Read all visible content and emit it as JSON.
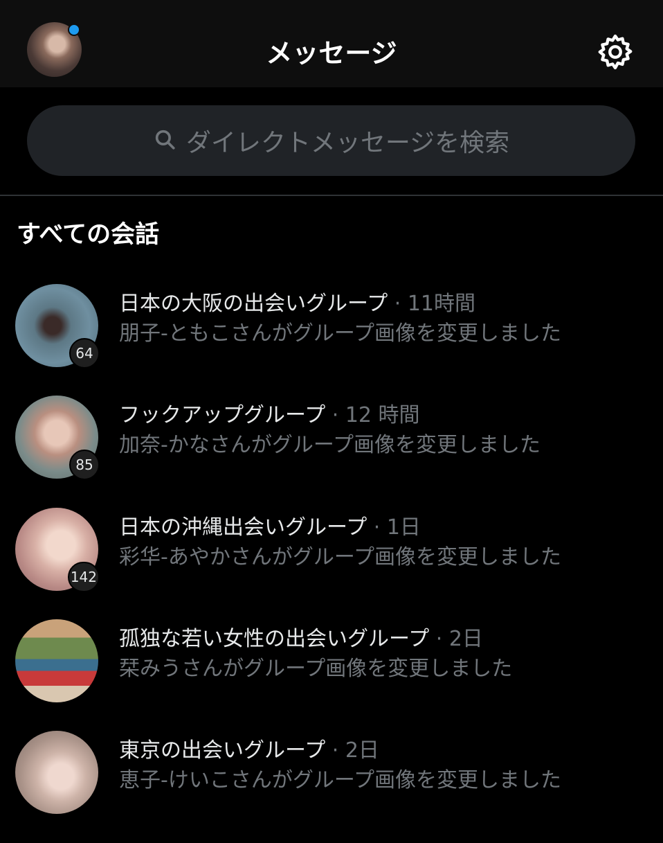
{
  "header": {
    "title": "メッセージ",
    "settings_icon": "gear-icon",
    "avatar_status_color": "#1d9bf0"
  },
  "search": {
    "placeholder": "ダイレクトメッセージを検索",
    "icon": "search-icon"
  },
  "section": {
    "title": "すべての会話"
  },
  "conversations": [
    {
      "name": "日本の大阪の出会いグループ",
      "time": "11時間",
      "message": "朋子-ともこさんがグループ画像を変更しました",
      "badge": "64"
    },
    {
      "name": "フックアップグループ",
      "time": "12 時間",
      "message": "加奈-かなさんがグループ画像を変更しました",
      "badge": "85"
    },
    {
      "name": "日本の沖縄出会いグループ",
      "time": "1日",
      "message": "彩华-あやかさんがグループ画像を変更しました",
      "badge": "142"
    },
    {
      "name": "孤独な若い女性の出会いグループ",
      "time": "2日",
      "message": "栞みうさんがグループ画像を変更しました",
      "badge": ""
    },
    {
      "name": "東京の出会いグループ",
      "time": "2日",
      "message": "恵子-けいこさんがグループ画像を変更しました",
      "badge": ""
    }
  ],
  "colors": {
    "background": "#000000",
    "header_background": "#0e0e0e",
    "search_background": "#202327",
    "primary_text": "#e7e9ea",
    "secondary_text": "#71767b",
    "accent": "#1d9bf0"
  }
}
